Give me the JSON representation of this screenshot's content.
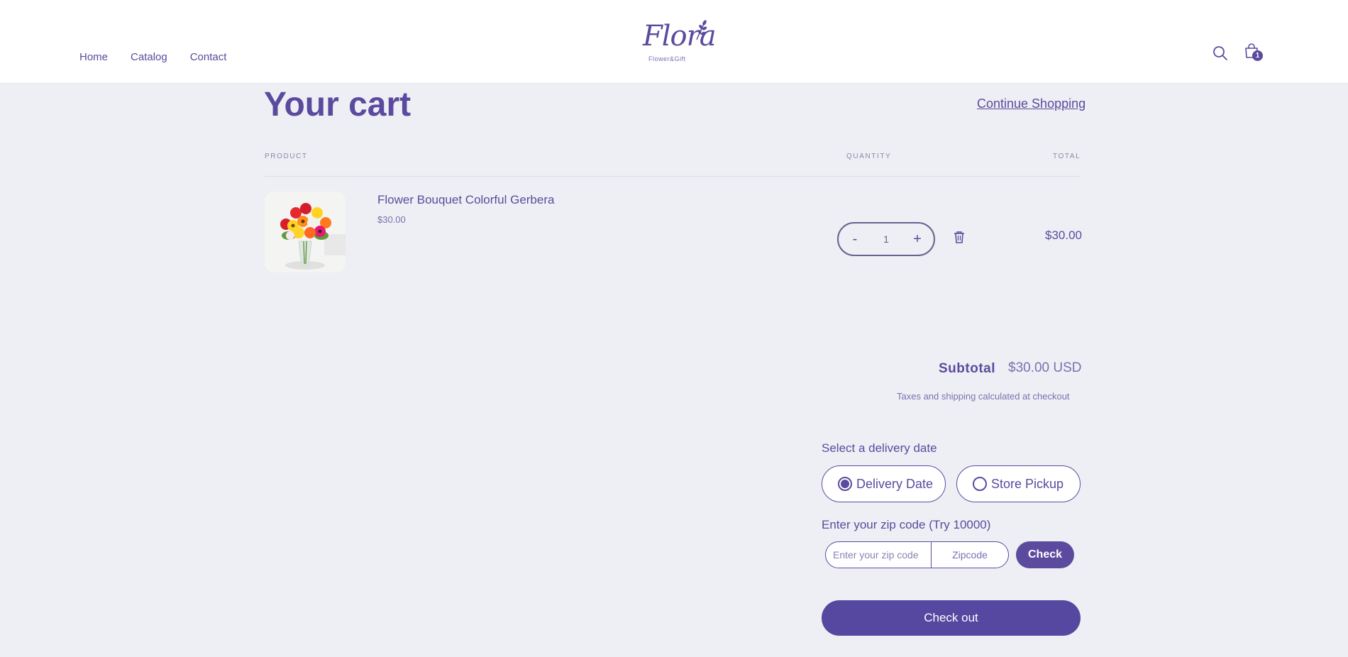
{
  "header": {
    "nav": [
      {
        "label": "Home"
      },
      {
        "label": "Catalog"
      },
      {
        "label": "Contact"
      }
    ],
    "logo_text": "Flora",
    "logo_sub": "Flower&Gift",
    "cart_count": "1",
    "icons": [
      "search-icon",
      "shopping-bag-icon"
    ]
  },
  "cart": {
    "title": "Your cart",
    "continue_label": "Continue Shopping",
    "columns": {
      "product": "PRODUCT",
      "quantity": "QUANTITY",
      "total": "TOTAL"
    },
    "items": [
      {
        "name": "Flower Bouquet Colorful Gerbera",
        "price": "$30.00",
        "quantity": "1",
        "total": "$30.00",
        "minus": "-",
        "plus": "+"
      }
    ],
    "subtotal_label": "Subtotal",
    "subtotal_value": "$30.00 USD",
    "tax_note": "Taxes and shipping calculated at checkout",
    "delivery": {
      "label": "Select a delivery date",
      "options": [
        {
          "label": "Delivery Date",
          "selected": true
        },
        {
          "label": "Store Pickup",
          "selected": false
        }
      ]
    },
    "zip": {
      "label": "Enter your zip code (Try 10000)",
      "placeholder": "Enter your zip code",
      "type_label": "Zipcode",
      "check_label": "Check"
    },
    "checkout_label": "Check out"
  },
  "colors": {
    "accent": "#5b4a9e",
    "background": "#eeeff4",
    "header_bg": "#ffffff"
  }
}
